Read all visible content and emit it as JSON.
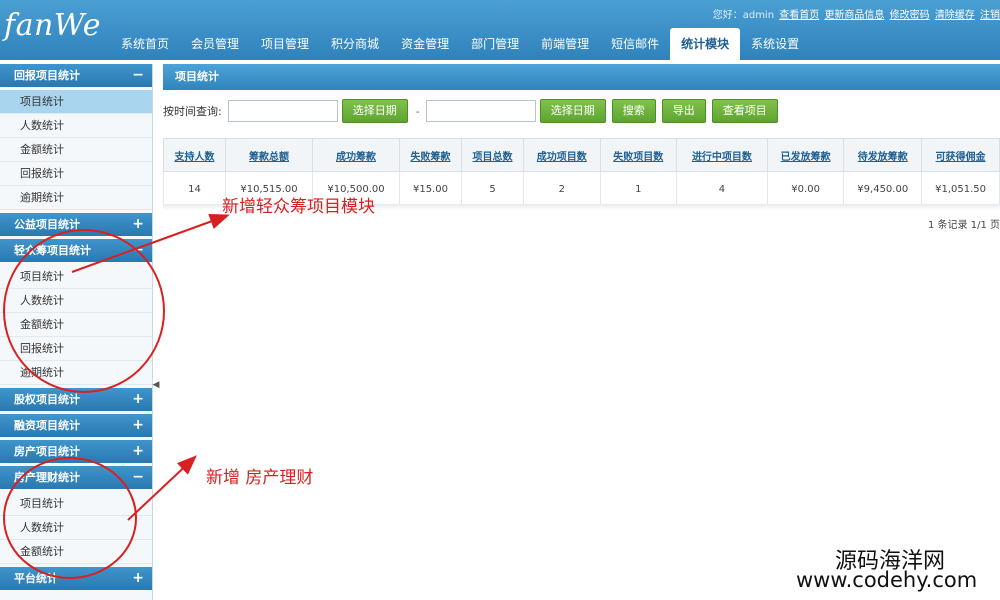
{
  "header": {
    "logo": "fanWe",
    "user_greeting": "您好：admin",
    "user_links": [
      "查看首页",
      "更新商品信息",
      "修改密码",
      "清除缓存",
      "注销"
    ],
    "nav": [
      {
        "label": "系统首页"
      },
      {
        "label": "会员管理"
      },
      {
        "label": "项目管理"
      },
      {
        "label": "积分商城"
      },
      {
        "label": "资金管理"
      },
      {
        "label": "部门管理"
      },
      {
        "label": "前端管理"
      },
      {
        "label": "短信邮件"
      },
      {
        "label": "统计模块"
      },
      {
        "label": "系统设置"
      }
    ],
    "active_nav": "统计模块"
  },
  "sidebar": {
    "sections": [
      {
        "title": "回报项目统计",
        "toggle": "−",
        "items": [
          "项目统计",
          "人数统计",
          "金额统计",
          "回报统计",
          "逾期统计"
        ]
      },
      {
        "title": "公益项目统计",
        "toggle": "+",
        "items": []
      },
      {
        "title": "轻众筹项目统计",
        "toggle": "−",
        "items": [
          "项目统计",
          "人数统计",
          "金额统计",
          "回报统计",
          "逾期统计"
        ]
      },
      {
        "title": "股权项目统计",
        "toggle": "+",
        "items": []
      },
      {
        "title": "融资项目统计",
        "toggle": "+",
        "items": []
      },
      {
        "title": "房产项目统计",
        "toggle": "+",
        "items": []
      },
      {
        "title": "房产理财统计",
        "toggle": "−",
        "items": [
          "项目统计",
          "人数统计",
          "金额统计"
        ]
      },
      {
        "title": "平台统计",
        "toggle": "+",
        "items": []
      }
    ]
  },
  "main": {
    "panel_title": "项目统计",
    "filter": {
      "label": "按时间查询:",
      "dash": "-",
      "select_date_1": "选择日期",
      "select_date_2": "选择日期",
      "search": "搜索",
      "export": "导出",
      "view": "查看项目"
    },
    "table": {
      "headers": [
        "支持人数",
        "筹款总额",
        "成功筹款",
        "失败筹款",
        "项目总数",
        "成功项目数",
        "失败项目数",
        "进行中项目数",
        "已发放筹款",
        "待发放筹款",
        "可获得佣金"
      ],
      "rows": [
        [
          "14",
          "¥10,515.00",
          "¥10,500.00",
          "¥15.00",
          "5",
          "2",
          "1",
          "4",
          "¥0.00",
          "¥9,450.00",
          "¥1,051.50"
        ]
      ]
    },
    "pager": "1 条记录 1/1 页"
  },
  "annotations": {
    "note1": "新增轻众筹项目模块",
    "note2": "新增 房产理财",
    "color": "#d92020"
  },
  "watermark": {
    "line1": "源码海洋网",
    "line2": "www.codehy.com"
  }
}
